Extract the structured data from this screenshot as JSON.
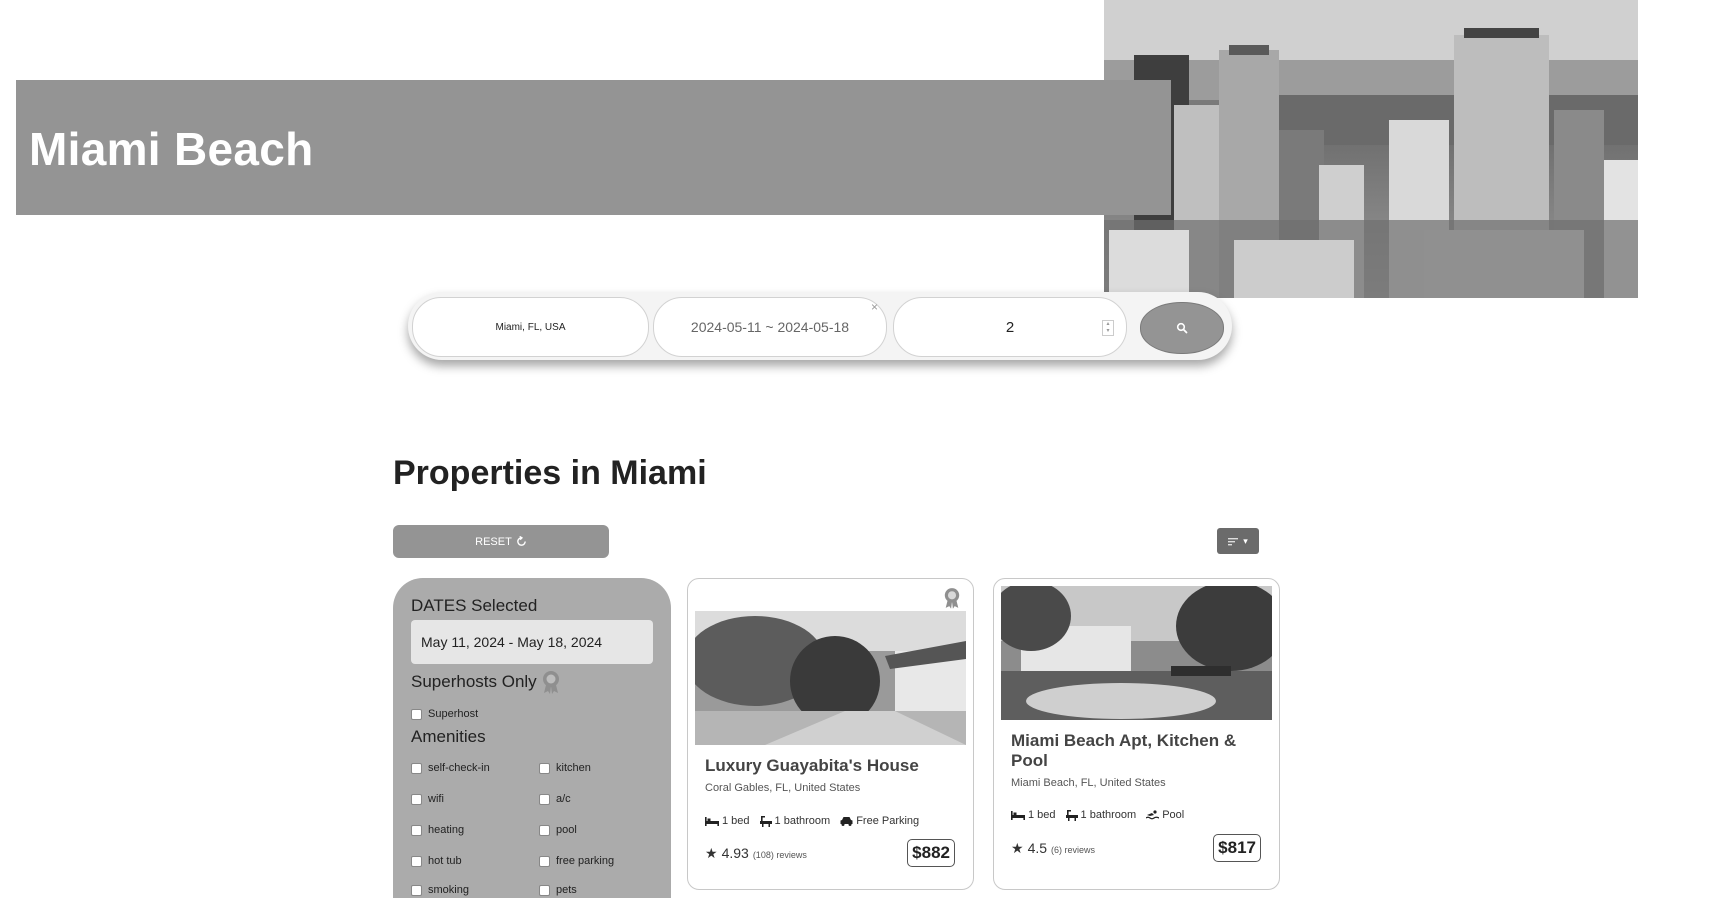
{
  "hero": {
    "title": "Miami Beach"
  },
  "search": {
    "location": "Miami, FL, USA",
    "dates": "2024-05-11 ~ 2024-05-18",
    "clear_glyph": "×",
    "guests": "2",
    "search_icon": "search-icon"
  },
  "section": {
    "title": "Properties in Miami"
  },
  "toolbar": {
    "reset_label": "RESET",
    "reset_icon": "refresh-icon",
    "sort_icon": "sort-dropdown-icon"
  },
  "filters": {
    "dates_heading": "DATES Selected",
    "dates_value": "May 11, 2024 - May 18, 2024",
    "superhosts_heading": "Superhosts Only",
    "superhost_label": "Superhost",
    "amenities_heading": "Amenities",
    "amenities": [
      {
        "label": "self-check-in"
      },
      {
        "label": "kitchen"
      },
      {
        "label": "wifi"
      },
      {
        "label": "a/c"
      },
      {
        "label": "heating"
      },
      {
        "label": "pool"
      },
      {
        "label": "hot tub"
      },
      {
        "label": "free parking"
      },
      {
        "label": "smoking"
      },
      {
        "label": "pets"
      }
    ]
  },
  "listings": [
    {
      "title": "Luxury Guayabita's House",
      "location": "Coral Gables, FL, United States",
      "features": [
        "1 bed",
        "1 bathroom",
        "Free Parking"
      ],
      "rating": "4.93",
      "reviews": "(108) reviews",
      "price": "$882",
      "superhost": true
    },
    {
      "title": "Miami Beach Apt, Kitchen & Pool",
      "location": "Miami Beach, FL, United States",
      "features": [
        "1 bed",
        "1 bathroom",
        "Pool"
      ],
      "rating": "4.5",
      "reviews": "(6) reviews",
      "price": "$817",
      "superhost": false
    }
  ]
}
